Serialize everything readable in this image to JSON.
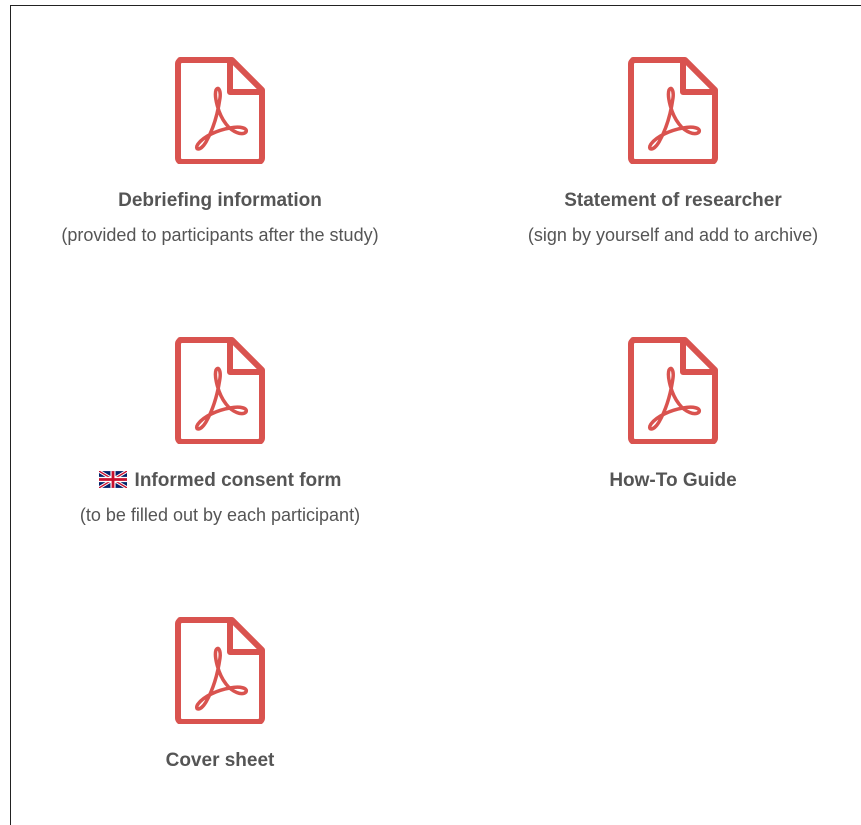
{
  "documents": [
    {
      "title": "Debriefing information",
      "subtitle": "(provided to participants after the study)",
      "icon": "pdf-icon",
      "has_flag": false
    },
    {
      "title": "Statement of researcher",
      "subtitle": "(sign by yourself and add to archive)",
      "icon": "pdf-icon",
      "has_flag": false
    },
    {
      "title": "Informed consent form",
      "subtitle": "(to be filled out by each participant)",
      "icon": "pdf-icon",
      "has_flag": true,
      "flag_icon": "uk-flag-icon"
    },
    {
      "title": "How-To Guide",
      "subtitle": "",
      "icon": "pdf-icon",
      "has_flag": false
    },
    {
      "title": "Cover sheet",
      "subtitle": "",
      "icon": "pdf-icon",
      "has_flag": false
    }
  ],
  "colors": {
    "pdf_red": "#d9534f",
    "text": "#555555",
    "border": "#222222"
  }
}
